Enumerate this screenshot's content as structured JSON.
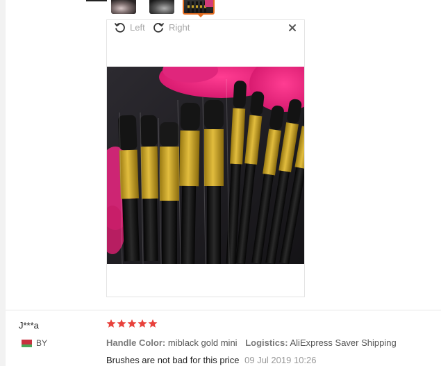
{
  "viewer": {
    "rotate_left_label": "Left",
    "rotate_right_label": "Right"
  },
  "review": {
    "reviewer_name": "J***a",
    "country_code": "BY",
    "rating": 5,
    "attributes": [
      {
        "key": "Handle Color:",
        "value": "miblack gold mini"
      },
      {
        "key": "Logistics:",
        "value": "AliExpress Saver Shipping"
      }
    ],
    "text": "Brushes are not bad for this price",
    "date": "09 Jul 2019 10:26"
  },
  "colors": {
    "star": "#e8413b",
    "selected_thumb_border": "#e46c1f",
    "gold_ferrule": "#c8a32a"
  }
}
